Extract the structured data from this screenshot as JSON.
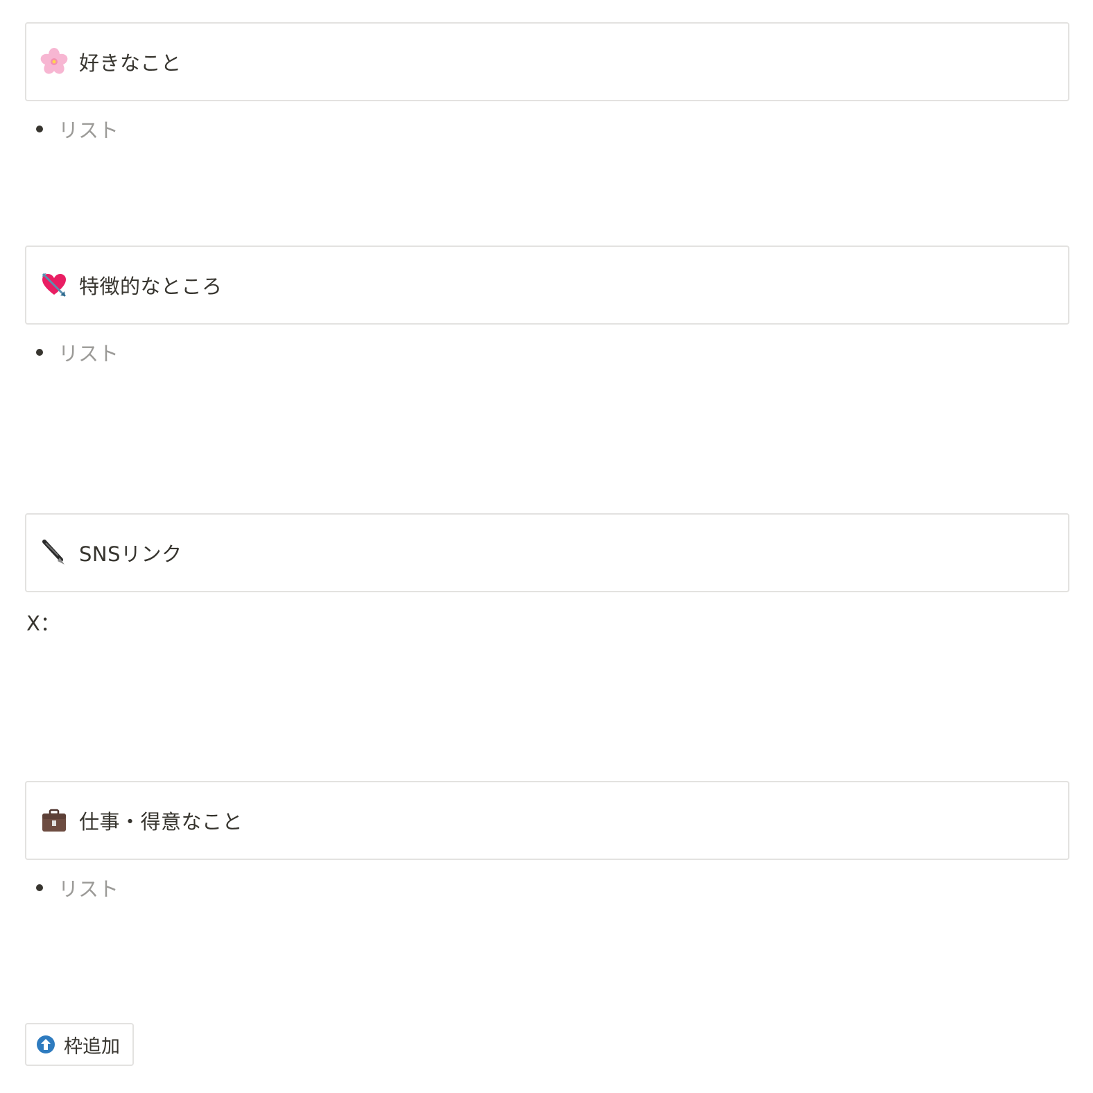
{
  "blocks": [
    {
      "icon": "cherry-blossom-icon",
      "title": "好きなこと",
      "items": [
        "リスト"
      ]
    },
    {
      "icon": "heart-with-arrow-icon",
      "title": "特徴的なところ",
      "items": [
        "リスト"
      ]
    },
    {
      "icon": "fountain-pen-icon",
      "title": "SNSリンク",
      "text": "X："
    },
    {
      "icon": "briefcase-icon",
      "title": "仕事・得意なこと",
      "items": [
        "リスト"
      ]
    }
  ],
  "add_button": {
    "icon": "up-arrow-circle-icon",
    "label": "枠追加"
  },
  "colors": {
    "border": "#e3e2e0",
    "text": "#37352f",
    "placeholder": "#9b9a97",
    "accent_blue": "#2e7bbf"
  }
}
